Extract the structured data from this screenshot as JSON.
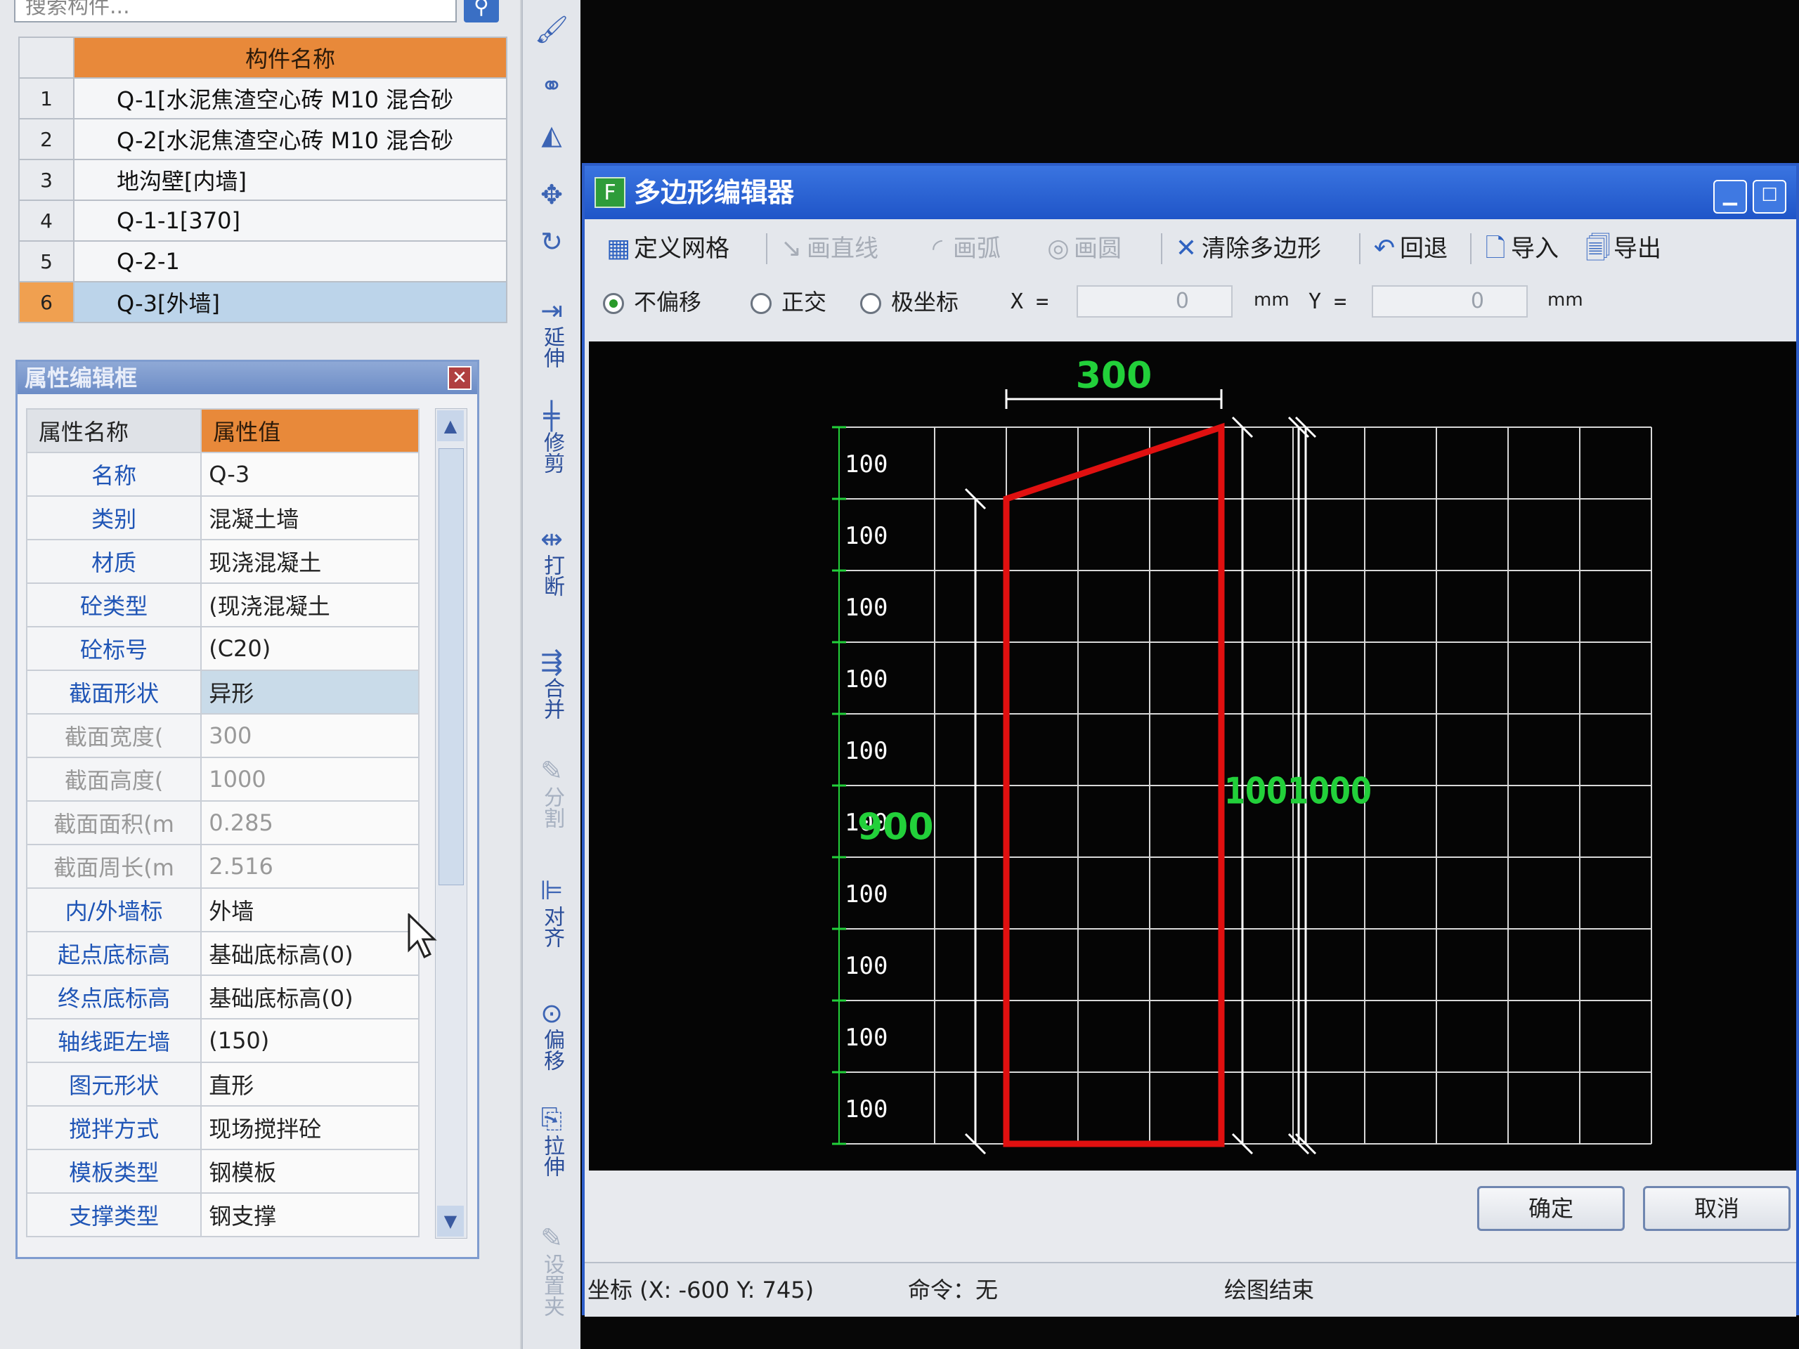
{
  "search": {
    "placeholder": "搜索构件..."
  },
  "component_list": {
    "header": "构件名称",
    "rows": [
      {
        "index": "1",
        "name": "Q-1[水泥焦渣空心砖 M10 混合砂"
      },
      {
        "index": "2",
        "name": "Q-2[水泥焦渣空心砖 M10 混合砂"
      },
      {
        "index": "3",
        "name": "地沟壁[内墙]"
      },
      {
        "index": "4",
        "name": "Q-1-1[370]"
      },
      {
        "index": "5",
        "name": "Q-2-1"
      },
      {
        "index": "6",
        "name": "Q-3[外墙]"
      }
    ]
  },
  "property_editor": {
    "title": "属性编辑框",
    "col_name": "属性名称",
    "col_value": "属性值",
    "rows": [
      {
        "name": "名称",
        "value": "Q-3"
      },
      {
        "name": "类别",
        "value": "混凝土墙"
      },
      {
        "name": "材质",
        "value": "现浇混凝土"
      },
      {
        "name": "砼类型",
        "value": "(现浇混凝土"
      },
      {
        "name": "砼标号",
        "value": "(C20)"
      },
      {
        "name": "截面形状",
        "value": "异形"
      },
      {
        "name": "截面宽度(",
        "value": "300"
      },
      {
        "name": "截面高度(",
        "value": "1000"
      },
      {
        "name": "截面面积(m",
        "value": "0.285"
      },
      {
        "name": "截面周长(m",
        "value": "2.516"
      },
      {
        "name": "内/外墙标",
        "value": "外墙"
      },
      {
        "name": "起点底标高",
        "value": "基础底标高(0)"
      },
      {
        "name": "终点底标高",
        "value": "基础底标高(0)"
      },
      {
        "name": "轴线距左墙",
        "value": "(150)"
      },
      {
        "name": "图元形状",
        "value": "直形"
      },
      {
        "name": "搅拌方式",
        "value": "现场搅拌砼"
      },
      {
        "name": "模板类型",
        "value": "钢模板"
      },
      {
        "name": "支撑类型",
        "value": "钢支撑"
      }
    ]
  },
  "vertical_toolbar": [
    {
      "label": "延伸",
      "icon": "extend-icon"
    },
    {
      "label": "修剪",
      "icon": "trim-icon"
    },
    {
      "label": "打断",
      "icon": "break-icon"
    },
    {
      "label": "合并",
      "icon": "merge-icon"
    },
    {
      "label": "分割",
      "icon": "split-icon"
    },
    {
      "label": "对齐",
      "icon": "align-icon"
    },
    {
      "label": "偏移",
      "icon": "offset-icon"
    },
    {
      "label": "拉伸",
      "icon": "stretch-icon"
    },
    {
      "label": "设置夹",
      "icon": "grip-icon"
    }
  ],
  "polygon_editor": {
    "title": "多边形编辑器",
    "toolbar": {
      "define_grid": "定义网格",
      "draw_line": "画直线",
      "draw_arc": "画弧",
      "draw_circle": "画圆",
      "clear_polygon": "清除多边形",
      "undo": "回退",
      "import": "导入",
      "export": "导出"
    },
    "options": {
      "no_offset": "不偏移",
      "orthogonal": "正交",
      "polar": "极坐标",
      "x_label": "X =",
      "x_value": "0",
      "y_label": "Y =",
      "y_value": "0",
      "unit": "mm"
    },
    "canvas": {
      "top_dim": "300",
      "row_labels": [
        "100",
        "100",
        "100",
        "100",
        "100",
        "100",
        "100",
        "100",
        "100",
        "100"
      ],
      "left_total": "900",
      "right_dims": "1001000",
      "grid_color": "#d8d8d8",
      "polygon_color": "#e01010",
      "dim_color": "#22d03a"
    },
    "ok_button": "确定",
    "cancel_button": "取消",
    "status": {
      "coord": "坐标 (X: -600 Y: 745)",
      "command": "命令：无",
      "message": "绘图结束"
    }
  }
}
